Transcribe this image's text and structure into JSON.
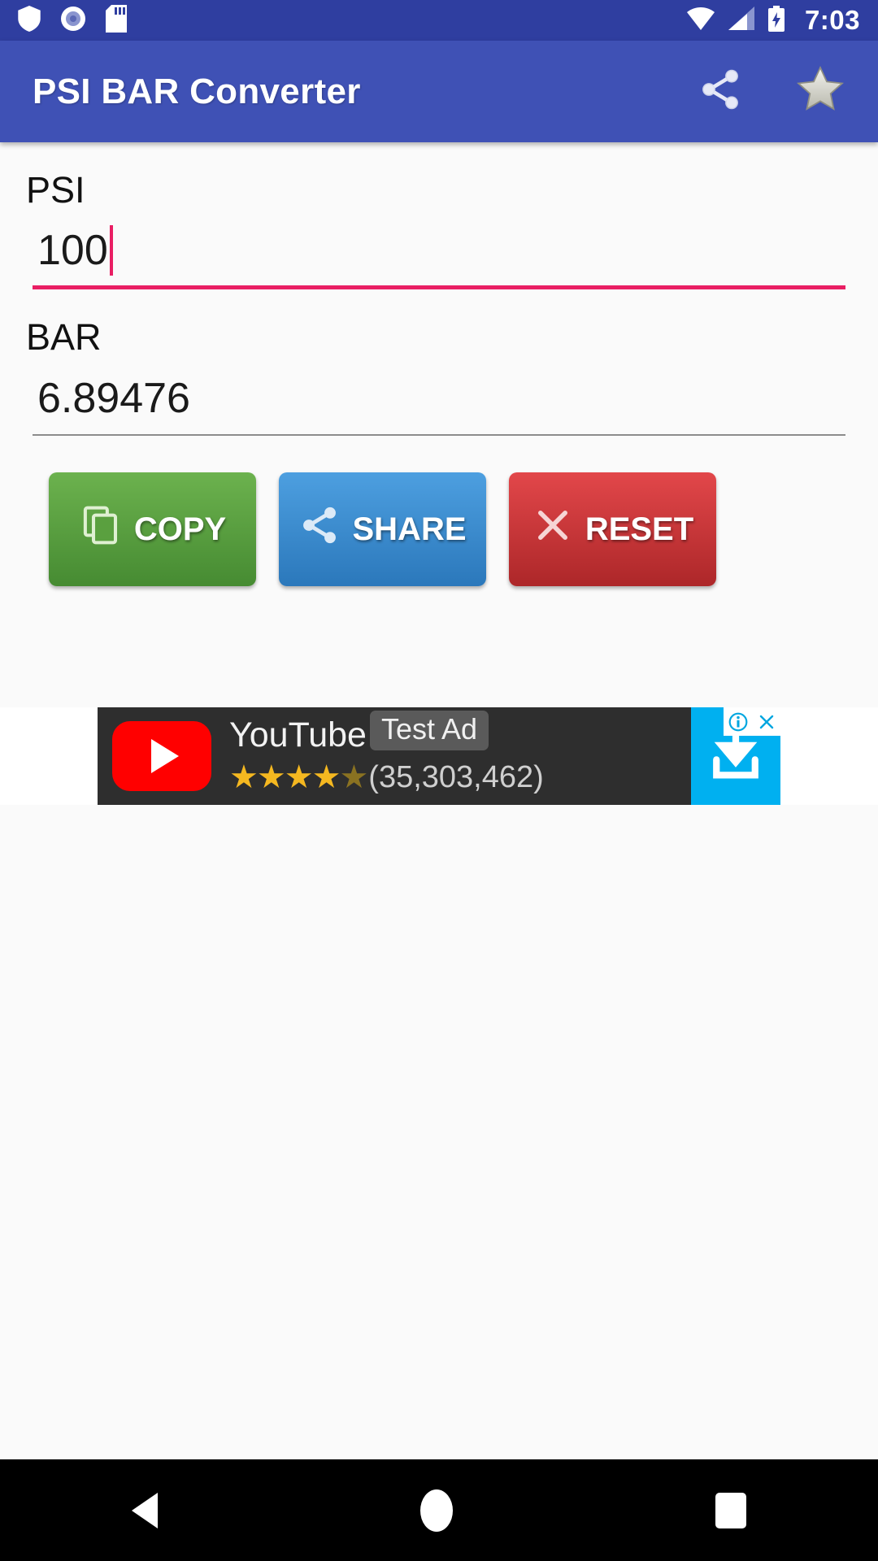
{
  "statusbar": {
    "time": "7:03",
    "icons_left": [
      "shield-icon",
      "record-circle-icon",
      "sd-card-icon"
    ],
    "icons_right": [
      "wifi-icon",
      "cellular-signal-icon",
      "battery-charging-icon"
    ],
    "background_color": "#2f3ea0"
  },
  "appbar": {
    "title": "PSI BAR Converter",
    "share_icon": "share-icon",
    "favorite_icon": "star-icon",
    "background_color": "#3f51b5"
  },
  "form": {
    "psi": {
      "label": "PSI",
      "value": "100",
      "placeholder": "",
      "underline_color": "#e91e63",
      "focused": true
    },
    "bar": {
      "label": "BAR",
      "value": "6.89476",
      "placeholder": "",
      "underline_color": "#8c8c8c",
      "focused": false
    }
  },
  "buttons": [
    {
      "label": "COPY",
      "icon": "copy-icon",
      "color": "#5aa03f"
    },
    {
      "label": "SHARE",
      "icon": "share-icon",
      "color": "#3b8dcd"
    },
    {
      "label": "RESET",
      "icon": "close-x-icon",
      "color": "#c8383b"
    }
  ],
  "ad": {
    "title": "YouTube",
    "badge": "Test Ad",
    "stars": "★★★★",
    "half_star": "★",
    "rating_count": "(35,303,462)",
    "cta_icon": "download-install-icon",
    "info_icon": "i",
    "close_icon": "✕",
    "cta_color": "#00b0f0",
    "background_color": "#2e2e2e"
  },
  "navbar": {
    "back": "back-triangle",
    "home": "home-circle",
    "recents": "recents-square"
  }
}
